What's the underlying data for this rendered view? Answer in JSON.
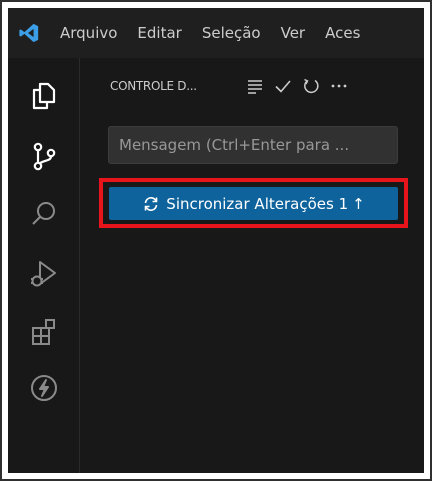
{
  "menubar": {
    "logo_icon": "vscode-logo-icon",
    "items": [
      "Arquivo",
      "Editar",
      "Seleção",
      "Ver",
      "Aces"
    ]
  },
  "activitybar": {
    "items": [
      {
        "icon": "explorer-icon"
      },
      {
        "icon": "source-control-icon"
      },
      {
        "icon": "search-icon"
      },
      {
        "icon": "run-debug-icon"
      },
      {
        "icon": "extensions-icon"
      },
      {
        "icon": "lightning-icon"
      }
    ]
  },
  "sidebar": {
    "title": "CONTROLE D...",
    "actions": [
      "list-view-icon",
      "commit-check-icon",
      "refresh-icon",
      "more-actions-icon"
    ]
  },
  "commit": {
    "placeholder": "Mensagem (Ctrl+Enter para ..."
  },
  "sync_button": {
    "label": "Sincronizar Alterações 1",
    "arrow": "↑",
    "icon": "sync-icon"
  },
  "colors": {
    "accent_button": "#0e639c",
    "highlight": "#e8141c",
    "background": "#1f1f1f"
  }
}
